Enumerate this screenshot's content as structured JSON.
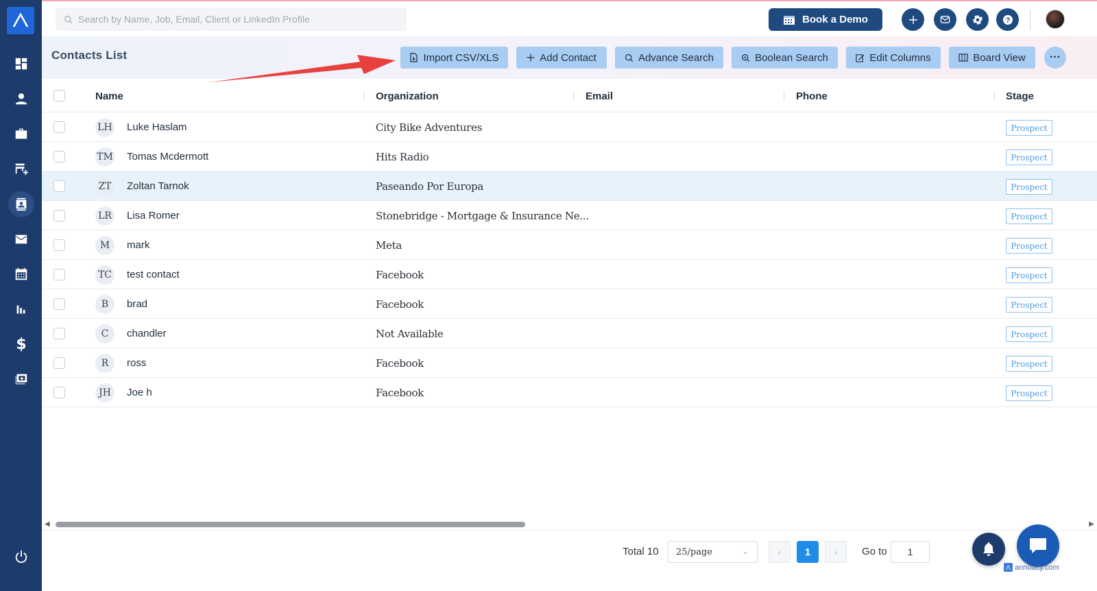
{
  "topbar": {
    "search_placeholder": "Search by Name, Job, Email, Client or LinkedIn Profile",
    "book_demo_label": "Book a Demo"
  },
  "header": {
    "title": "Contacts List",
    "buttons": {
      "import": "Import CSV/XLS",
      "add": "Add Contact",
      "advance": "Advance Search",
      "boolean": "Boolean Search",
      "edit_columns": "Edit Columns",
      "board": "Board View",
      "more": "···"
    }
  },
  "table": {
    "columns": {
      "name": "Name",
      "organization": "Organization",
      "email": "Email",
      "phone": "Phone",
      "stage": "Stage"
    },
    "rows": [
      {
        "initials": "LH",
        "name": "Luke Haslam",
        "organization": "City Bike Adventures",
        "stage": "Prospect"
      },
      {
        "initials": "TM",
        "name": "Tomas Mcdermott",
        "organization": "Hits Radio",
        "stage": "Prospect"
      },
      {
        "initials": "ZT",
        "name": "Zoltan Tarnok",
        "organization": "Paseando Por Europa",
        "stage": "Prospect"
      },
      {
        "initials": "LR",
        "name": "Lisa Romer",
        "organization": "Stonebridge - Mortgage & Insurance Ne...",
        "stage": "Prospect"
      },
      {
        "initials": "M",
        "name": "mark",
        "organization": "Meta",
        "stage": "Prospect"
      },
      {
        "initials": "TC",
        "name": "test contact",
        "organization": "Facebook",
        "stage": "Prospect"
      },
      {
        "initials": "B",
        "name": "brad",
        "organization": "Facebook",
        "stage": "Prospect"
      },
      {
        "initials": "C",
        "name": "chandler",
        "organization": "Not Available",
        "stage": "Prospect"
      },
      {
        "initials": "R",
        "name": "ross",
        "organization": "Facebook",
        "stage": "Prospect"
      },
      {
        "initials": "JH",
        "name": "Joe h",
        "organization": "Facebook",
        "stage": "Prospect"
      }
    ]
  },
  "pagination": {
    "total": "Total 10",
    "page_size": "25/page",
    "current_page": "1",
    "goto_label": "Go to",
    "goto_value": "1",
    "prev": "‹",
    "next": "›"
  },
  "watermark": "annotely.com",
  "colors": {
    "sidebar": "#1d3b6b",
    "button_bg": "#a9ccf2",
    "primary": "#1f4a7f",
    "stage_badge": "#4a9be6",
    "page_active": "#1f8ce8",
    "arrow": "#e8413d"
  }
}
